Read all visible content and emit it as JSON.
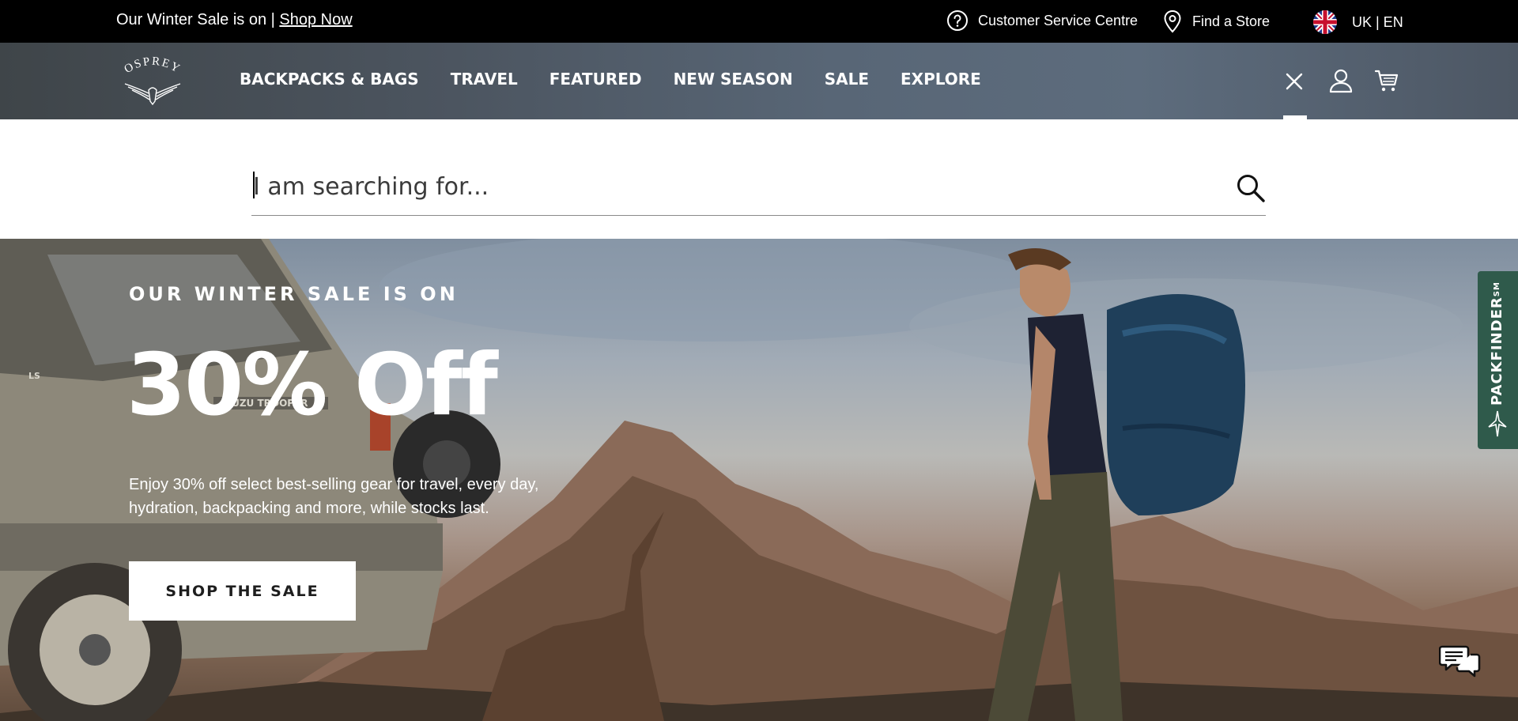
{
  "promo_bar": {
    "text": "Our Winter Sale is on |",
    "link": "Shop Now",
    "customer_service": "Customer Service Centre",
    "find_store": "Find a Store",
    "locale": "UK | EN"
  },
  "header": {
    "logo_text": "OSPREY",
    "nav": [
      {
        "label": "BACKPACKS & BAGS"
      },
      {
        "label": "TRAVEL"
      },
      {
        "label": "FEATURED"
      },
      {
        "label": "NEW SEASON"
      },
      {
        "label": "SALE"
      },
      {
        "label": "EXPLORE"
      }
    ]
  },
  "search": {
    "placeholder": "I am searching for...",
    "value": ""
  },
  "hero": {
    "eyebrow": "OUR WINTER SALE IS ON",
    "headline": "30% Off",
    "body": "Enjoy 30% off select best-selling gear for travel, every day, hydration, backpacking and more, while stocks last.",
    "cta": "SHOP THE SALE",
    "vehicle_badge": "ISUZU TROOPER",
    "vehicle_trim": "LS"
  },
  "packfinder": {
    "label": "PACKFINDER",
    "mark": "SM"
  },
  "colors": {
    "promo_bg": "#000000",
    "packfinder_bg": "#2f5a4b",
    "cta_bg": "#ffffff"
  },
  "icons": [
    "help-circle-icon",
    "map-pin-icon",
    "uk-flag-icon",
    "close-icon",
    "account-icon",
    "cart-icon",
    "search-icon",
    "chat-icon",
    "osprey-bird-icon"
  ]
}
